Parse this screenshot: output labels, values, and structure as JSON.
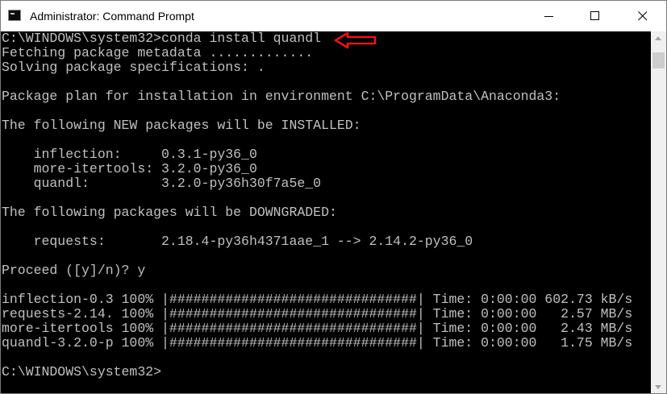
{
  "window": {
    "title": "Administrator: Command Prompt",
    "icon": "command-prompt-icon",
    "controls": {
      "minimize_icon": "minimize-icon",
      "maximize_icon": "maximize-icon",
      "close_icon": "close-icon"
    }
  },
  "console": {
    "text_color": "#c0c0c0",
    "background": "#000000",
    "lines": [
      "C:\\WINDOWS\\system32>conda install quandl",
      "Fetching package metadata .............",
      "Solving package specifications: .",
      "",
      "Package plan for installation in environment C:\\ProgramData\\Anaconda3:",
      "",
      "The following NEW packages will be INSTALLED:",
      "",
      "    inflection:     0.3.1-py36_0",
      "    more-itertools: 3.2.0-py36_0",
      "    quandl:         3.2.0-py36h30f7a5e_0",
      "",
      "The following packages will be DOWNGRADED:",
      "",
      "    requests:       2.18.4-py36h4371aae_1 --> 2.14.2-py36_0",
      "",
      "Proceed ([y]/n)? y",
      "",
      "inflection-0.3 100% |###############################| Time: 0:00:00 602.73 kB/s",
      "requests-2.14. 100% |###############################| Time: 0:00:00   2.57 MB/s",
      "more-itertools 100% |###############################| Time: 0:00:00   2.43 MB/s",
      "quandl-3.2.0-p 100% |###############################| Time: 0:00:00   1.75 MB/s",
      "",
      "C:\\WINDOWS\\system32>"
    ]
  },
  "annotation": {
    "icon": "red-arrow-icon",
    "color": "#e8141b"
  },
  "scrollbar": {
    "up_icon": "scroll-up-arrow-icon",
    "down_icon": "scroll-down-arrow-icon"
  }
}
